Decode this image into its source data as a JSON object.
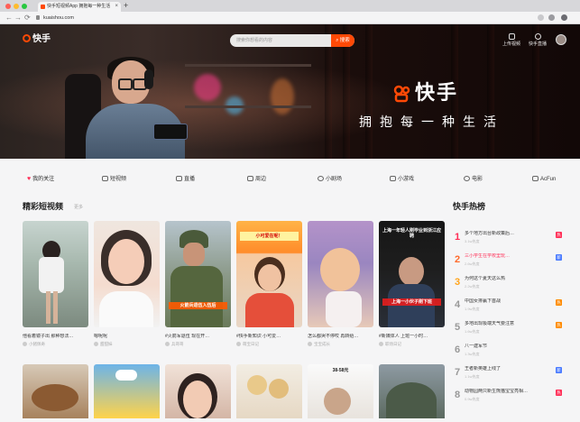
{
  "browser": {
    "tab_title": "快手短视频App 拥抱每一种生活",
    "tab_close": "×",
    "new_tab": "+",
    "url": "kuaishou.com",
    "back": "←",
    "forward": "→",
    "reload": "⟳"
  },
  "header": {
    "logo_text": "快手",
    "search_placeholder": "搜索你想看的内容",
    "search_button": "搜索",
    "upload_label": "上传视频",
    "client_label": "快手直播"
  },
  "hero": {
    "brand_name": "快手",
    "slogan": "拥抱每一种生活"
  },
  "categories": [
    {
      "label": "我的关注",
      "icon": "heart-icon",
      "active": true
    },
    {
      "label": "短视频",
      "icon": "video-icon"
    },
    {
      "label": "直播",
      "icon": "live-icon"
    },
    {
      "label": "周边",
      "icon": "shop-icon"
    },
    {
      "label": "小剧场",
      "icon": "theater-icon"
    },
    {
      "label": "小游戏",
      "icon": "game-icon"
    },
    {
      "label": "电影",
      "icon": "film-icon"
    },
    {
      "label": "AcFun",
      "icon": "acfun-icon"
    }
  ],
  "section": {
    "title": "精彩短视频",
    "subtitle": "更多"
  },
  "videos": [
    {
      "title": "他看着镜子出 那种想法…",
      "author": "小猪佩奇"
    },
    {
      "title": "嗯呢呢",
      "author": "甜甜妹"
    },
    {
      "title": "#火箭军退伍 现在开…",
      "author": "兵哥哥"
    },
    {
      "title": "#快手新知识 小可爱…",
      "author": "萌宝日记",
      "overlay": "小可爱在呢！"
    },
    {
      "title": "怎么都哭不停哎 再转给…",
      "author": "宝宝成长"
    },
    {
      "title": "#新媒体人 上班一小时…",
      "author": "职场日记",
      "overlay_top": "上海一年轻人刚毕业到浙江应聘",
      "overlay_bottom": "上海一小伙子刚下班"
    }
  ],
  "videos_row2_overlay": "38-58元",
  "row1_overlays": {
    "card3_caption": "火箭兵退伍入伍后",
    "card4_caption": "小可爱在呢！"
  },
  "hot": {
    "title": "快手热榜",
    "items": [
      {
        "rank": "1",
        "text": "多个地方出台新政策后…",
        "meta": "3.1w热度",
        "badge": "热",
        "badge_color": "#ff2c55"
      },
      {
        "rank": "2",
        "text": "三小学生在学校里玩…",
        "meta": "2.6w热度",
        "badge": "新",
        "badge_color": "#4a7bff"
      },
      {
        "rank": "3",
        "text": "为何这个夏天这么热",
        "meta": "2.2w热度",
        "badge": "",
        "badge_color": ""
      },
      {
        "rank": "4",
        "text": "中国女排赢下首战",
        "meta": "1.9w热度",
        "badge": "热",
        "badge_color": "#ff8a00"
      },
      {
        "rank": "5",
        "text": "多地出现极端天气要注意",
        "meta": "1.6w热度",
        "badge": "热",
        "badge_color": "#ff8a00"
      },
      {
        "rank": "6",
        "text": "八一建军节",
        "meta": "1.3w热度",
        "badge": "",
        "badge_color": ""
      },
      {
        "rank": "7",
        "text": "王者新英雄上线了",
        "meta": "1.1w热度",
        "badge": "新",
        "badge_color": "#4a7bff"
      },
      {
        "rank": "8",
        "text": "动物园两只新生熊猫宝宝亮相…",
        "meta": "0.9w热度",
        "badge": "热",
        "badge_color": "#ff2c55"
      }
    ]
  }
}
